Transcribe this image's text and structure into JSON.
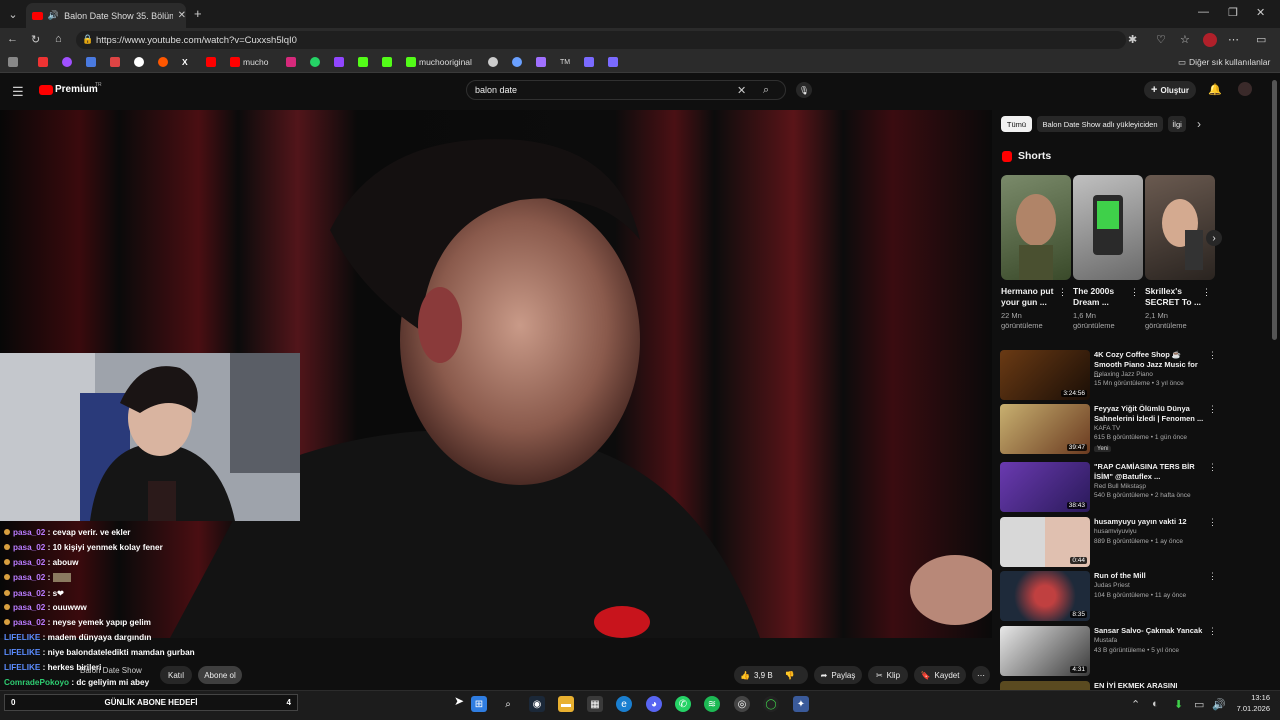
{
  "browser": {
    "tab_title": "Balon Date Show 35. Bölüm ...",
    "new_tab": "+",
    "url": "https://www.youtube.com/watch?v=Cuxxsh5lqI0",
    "bookmarks": [
      "mucho",
      "muchooriginal"
    ],
    "favorites_label": "Diğer sık kullanılanlar"
  },
  "youtube": {
    "logo": "Premium",
    "logo_sup": "TR",
    "search_value": "balon date",
    "create_label": "Oluştur"
  },
  "chat": [
    {
      "user": "pasa_02",
      "msg": "cevap verir. ve ekler",
      "color": "#b97bff"
    },
    {
      "user": "pasa_02",
      "msg": "10 kişiyi yenmek kolay fener",
      "color": "#b97bff"
    },
    {
      "user": "pasa_02",
      "msg": "abouw",
      "color": "#b97bff"
    },
    {
      "user": "pasa_02",
      "msg": "",
      "color": "#b97bff"
    },
    {
      "user": "pasa_02",
      "msg": "s❤",
      "color": "#b97bff"
    },
    {
      "user": "pasa_02",
      "msg": "ouuwww",
      "color": "#b97bff"
    },
    {
      "user": "pasa_02",
      "msg": "neyse yemek yapıp gelim",
      "color": "#b97bff"
    },
    {
      "user": "LIFELIKE",
      "msg": "madem dünyaya dargındın",
      "color": "#5b8cff"
    },
    {
      "user": "LIFELIKE",
      "msg": "niye balondateledikti mamdan gurban",
      "color": "#5b8cff"
    },
    {
      "user": "LIFELIKE",
      "msg": "herkes birileri",
      "color": "#5b8cff"
    },
    {
      "user": "ComradePokoyo",
      "msg": "dc geliyim mi abey",
      "color": "#2ecc71"
    }
  ],
  "under_video": {
    "channel": "Balon Date Show",
    "join": "Katıl",
    "subscribe": "Abone ol",
    "likes": "3,9 B",
    "share": "Paylaş",
    "clip": "Klip",
    "save": "Kaydet"
  },
  "chips": [
    "Tümü",
    "Balon Date Show adlı yükleyiciden",
    "İlgi"
  ],
  "shorts_heading": "Shorts",
  "shorts": [
    {
      "title": "Hermano put your gun ...",
      "views": "22 Mn görüntüleme"
    },
    {
      "title": "The 2000s Dream ...",
      "views": "1,6 Mn görüntüleme"
    },
    {
      "title": "Skrillex's SECRET To ...",
      "views": "2,1 Mn görüntüleme"
    }
  ],
  "recommended": [
    {
      "title": "4K Cozy Coffee Shop ☕ Smooth Piano Jazz Music for ...",
      "channel": "Relaxing Jazz Piano",
      "meta": "15 Mn görüntüleme • 3 yıl önce",
      "duration": "3:24:56",
      "badge": ""
    },
    {
      "title": "Feyyaz Yiğit Ölümlü Dünya Sahnelerini İzledi | Fenomen ...",
      "channel": "KAFA TV",
      "meta": "615 B görüntüleme • 1 gün önce",
      "duration": "39:47",
      "badge": "Yeni"
    },
    {
      "title": "\"RAP CAMİASINA TERS BİR İSİM\" @Batuflex ...",
      "channel": "Red Bull Mikstaşp",
      "meta": "540 B görüntüleme • 2 hafta önce",
      "duration": "38:43",
      "badge": ""
    },
    {
      "title": "husamyuyu yayın vakti 12",
      "channel": "husamviyuviyu",
      "meta": "889 B görüntüleme • 1 ay önce",
      "duration": "0:44",
      "badge": ""
    },
    {
      "title": "Run of the Mill",
      "channel": "Judas Priest",
      "meta": "104 B görüntüleme • 11 ay önce",
      "duration": "8:35",
      "badge": ""
    },
    {
      "title": "Sansar Salvo- Çakmak Yancak",
      "channel": "Mustafa",
      "meta": "43 B görüntüleme • 5 yıl önce",
      "duration": "4:31",
      "badge": ""
    },
    {
      "title": "EN İYİ EKMEK ARASINI",
      "channel": "",
      "meta": "",
      "duration": "",
      "badge": ""
    }
  ],
  "goal_bar": {
    "left": "0",
    "label": "GÜNLİK ABONE HEDEFİ",
    "right": "4"
  },
  "clock": {
    "time": "13:16",
    "date": "7.01.2026"
  },
  "colors": {
    "youtube_red": "#ff0000",
    "bg": "#0f0f0f",
    "taskbar": "#1c1c1c"
  }
}
